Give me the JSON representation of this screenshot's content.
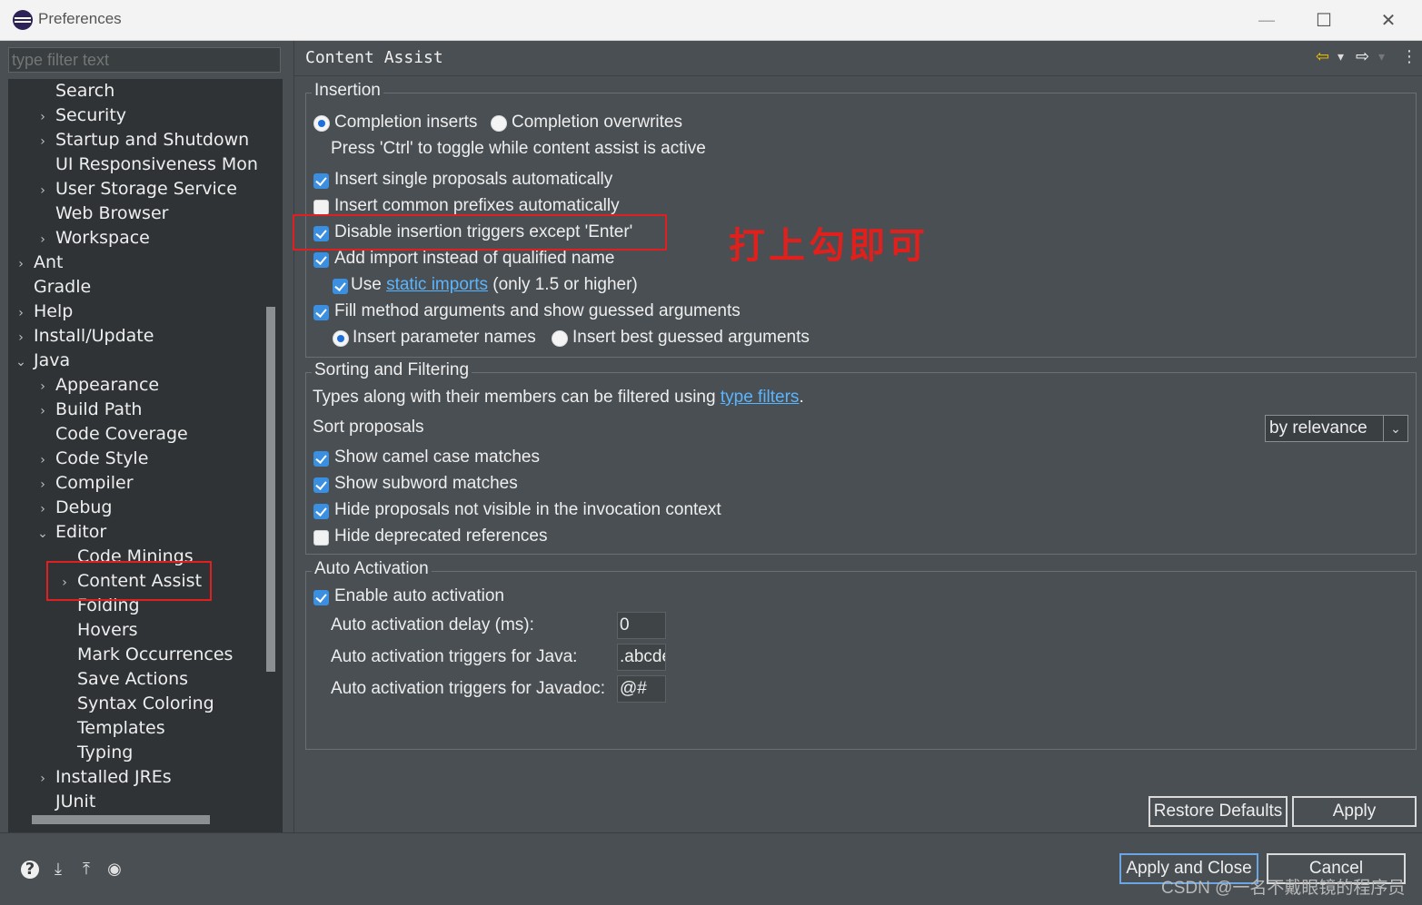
{
  "window": {
    "title": "Preferences",
    "min": "—",
    "max": "☐",
    "close": "✕"
  },
  "left": {
    "filter_placeholder": "type filter text",
    "tree": [
      {
        "label": "Search",
        "expand": ""
      },
      {
        "label": "Security",
        "expand": "›"
      },
      {
        "label": "Startup and Shutdown",
        "expand": "›"
      },
      {
        "label": "UI Responsiveness Monito",
        "expand": ""
      },
      {
        "label": "User Storage Service",
        "expand": "›"
      },
      {
        "label": "Web Browser",
        "expand": ""
      },
      {
        "label": "Workspace",
        "expand": "›"
      },
      {
        "label": "Ant",
        "expand": "›"
      },
      {
        "label": "Gradle",
        "expand": ""
      },
      {
        "label": "Help",
        "expand": "›"
      },
      {
        "label": "Install/Update",
        "expand": "›"
      },
      {
        "label": "Java",
        "expand": "⌄"
      },
      {
        "label": "Appearance",
        "expand": "›"
      },
      {
        "label": "Build Path",
        "expand": "›"
      },
      {
        "label": "Code Coverage",
        "expand": ""
      },
      {
        "label": "Code Style",
        "expand": "›"
      },
      {
        "label": "Compiler",
        "expand": "›"
      },
      {
        "label": "Debug",
        "expand": "›"
      },
      {
        "label": "Editor",
        "expand": "⌄"
      },
      {
        "label": "Code Minings",
        "expand": ""
      },
      {
        "label": "Content Assist",
        "expand": "›"
      },
      {
        "label": "Folding",
        "expand": ""
      },
      {
        "label": "Hovers",
        "expand": ""
      },
      {
        "label": "Mark Occurrences",
        "expand": ""
      },
      {
        "label": "Save Actions",
        "expand": ""
      },
      {
        "label": "Syntax Coloring",
        "expand": ""
      },
      {
        "label": "Templates",
        "expand": ""
      },
      {
        "label": "Typing",
        "expand": ""
      },
      {
        "label": "Installed JREs",
        "expand": "›"
      },
      {
        "label": "JUnit",
        "expand": ""
      }
    ]
  },
  "page": {
    "title": "Content Assist",
    "nav_back": "⇦",
    "nav_forward": "⇨",
    "nav_dropdown": "▾",
    "menu": "⋮",
    "insertion": {
      "title": "Insertion",
      "completion_inserts": "Completion inserts",
      "completion_overwrites": "Completion overwrites",
      "toggle_hint": "Press 'Ctrl' to toggle while content assist is active",
      "insert_single": "Insert single proposals automatically",
      "insert_common": "Insert common prefixes automatically",
      "disable_triggers": "Disable insertion triggers except 'Enter'",
      "add_import": "Add import instead of qualified name",
      "use_label": "Use",
      "static_imports": "static imports",
      "use_suffix": "(only 1.5 or higher)",
      "fill_method": "Fill method arguments and show guessed arguments",
      "insert_param_names": "Insert parameter names",
      "insert_best_guessed": "Insert best guessed arguments"
    },
    "sorting": {
      "title": "Sorting and Filtering",
      "types_text": "Types along with their members can be filtered using",
      "type_filters": "type filters",
      "period": ".",
      "sort_proposals": "Sort proposals",
      "sort_value": "by relevance",
      "show_camel": "Show camel case matches",
      "show_subword": "Show subword matches",
      "hide_not_visible": "Hide proposals not visible in the invocation context",
      "hide_deprecated": "Hide deprecated references"
    },
    "auto": {
      "title": "Auto Activation",
      "enable": "Enable auto activation",
      "delay_label": "Auto activation delay (ms):",
      "delay_value": "0",
      "java_label": "Auto activation triggers for Java:",
      "java_value": ".abcde",
      "javadoc_label": "Auto activation triggers for Javadoc:",
      "javadoc_value": "@#"
    },
    "restore_defaults": "Restore Defaults",
    "apply": "Apply"
  },
  "annotation": {
    "text": "打上勾即可",
    "color": "#e0201c"
  },
  "bottom": {
    "help_icon": "?",
    "import_icon": "⤓",
    "export_icon": "⤒",
    "record_icon": "◉",
    "apply_close": "Apply and Close",
    "cancel": "Cancel"
  },
  "watermark": "CSDN @一名不戴眼镜的程序员"
}
